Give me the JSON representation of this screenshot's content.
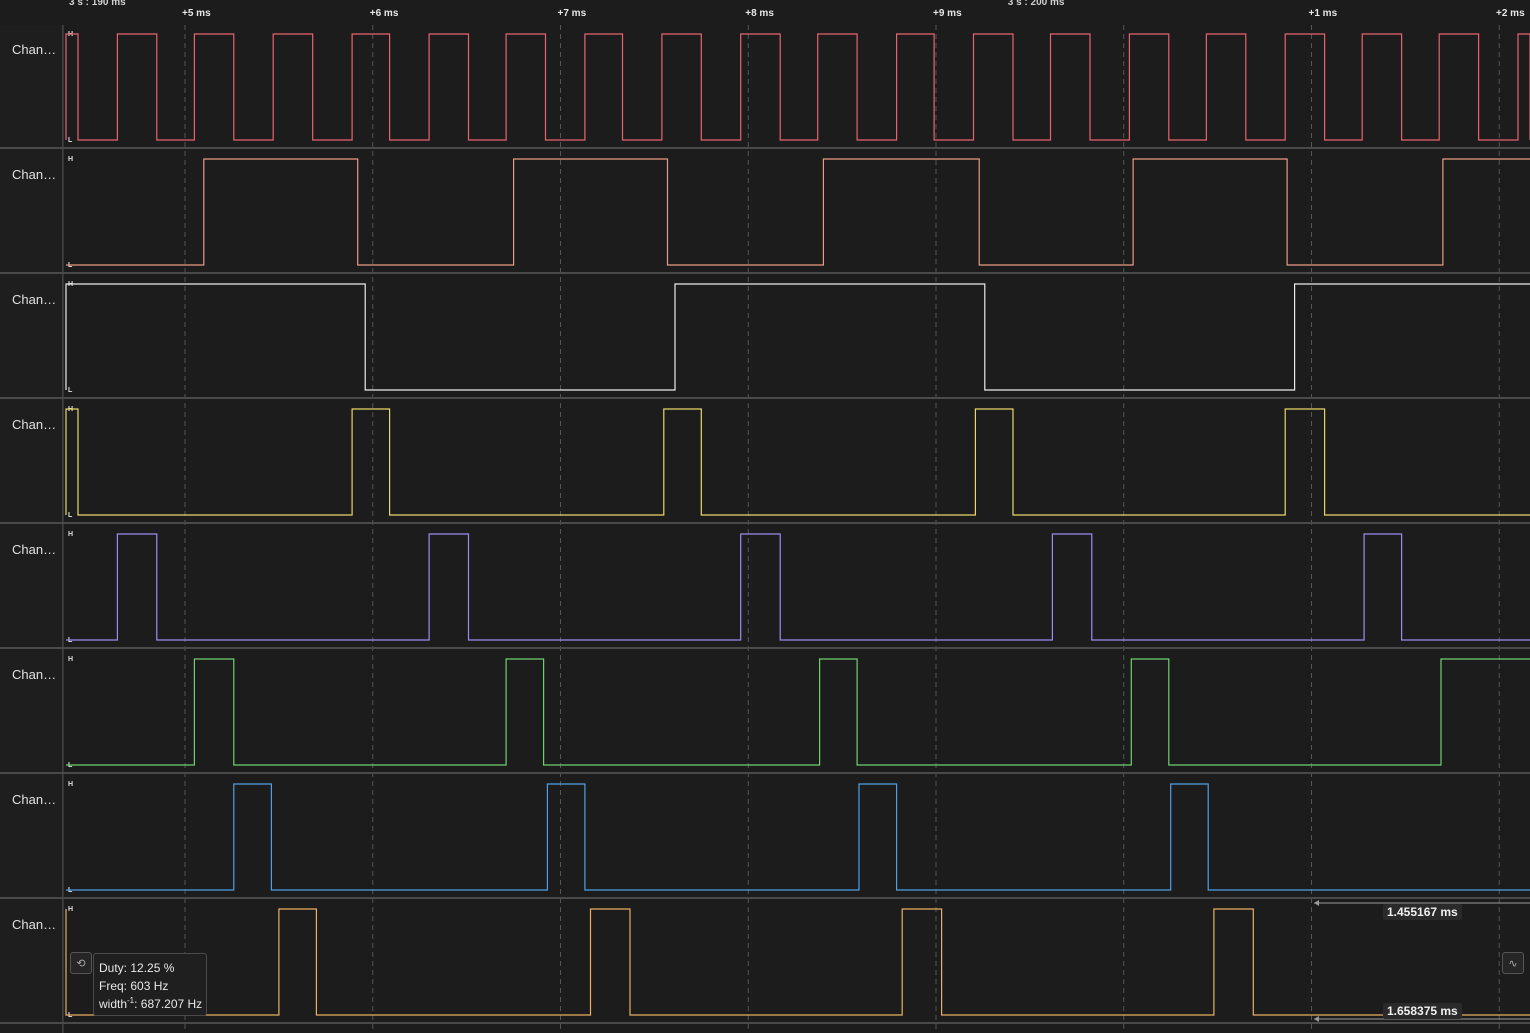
{
  "ruler": {
    "ticks": [
      {
        "text": "3 s : 190 ms",
        "time_ms": 3190.0,
        "absolute": true
      },
      {
        "text": "+5 ms",
        "time_ms": 3195.0
      },
      {
        "text": "+6 ms",
        "time_ms": 3196.0
      },
      {
        "text": "+7 ms",
        "time_ms": 3197.0
      },
      {
        "text": "+8 ms",
        "time_ms": 3198.0
      },
      {
        "text": "+9 ms",
        "time_ms": 3199.0
      },
      {
        "text": "3 s : 200 ms",
        "time_ms": 3200.0,
        "absolute": true
      },
      {
        "text": "+1 ms",
        "time_ms": 3201.0
      },
      {
        "text": "+2 ms",
        "time_ms": 3202.0
      }
    ]
  },
  "channels": [
    {
      "label": "Chan…",
      "color": "#e8636f",
      "high": "H",
      "low": "L",
      "start_level": 0,
      "transitions_ms": [
        3194.23,
        3194.43,
        3194.64,
        3194.85,
        3195.05,
        3195.26,
        3195.47,
        3195.68,
        3195.89,
        3196.09,
        3196.3,
        3196.51,
        3196.71,
        3196.92,
        3197.13,
        3197.33,
        3197.54,
        3197.75,
        3197.96,
        3198.17,
        3198.37,
        3198.58,
        3198.79,
        3198.99,
        3199.2,
        3199.41,
        3199.61,
        3199.82,
        3200.03,
        3200.24,
        3200.44,
        3200.65,
        3200.86,
        3201.07,
        3201.27,
        3201.48,
        3201.68,
        3201.89,
        3202.1,
        3202.31
      ]
    },
    {
      "label": "Chan…",
      "color": "#e89a82",
      "high": "H",
      "low": "L",
      "start_level": 0,
      "transitions_ms": [
        3195.1,
        3195.92,
        3196.75,
        3197.57,
        3198.4,
        3199.23,
        3200.05,
        3200.87,
        3201.7
      ]
    },
    {
      "label": "Chan…",
      "color": "#ececec",
      "high": "H",
      "low": "L",
      "start_level": 0,
      "transitions_ms": [
        3194.31,
        3195.96,
        3197.61,
        3199.26,
        3200.91
      ]
    },
    {
      "label": "Chan…",
      "color": "#e8d66a",
      "high": "H",
      "low": "L",
      "start_level": 0,
      "transitions_ms": [
        3194.23,
        3194.43,
        3195.89,
        3196.09,
        3197.55,
        3197.75,
        3199.21,
        3199.41,
        3200.86,
        3201.07
      ]
    },
    {
      "label": "Chan…",
      "color": "#9c8cf0",
      "high": "H",
      "low": "L",
      "start_level": 0,
      "transitions_ms": [
        3194.64,
        3194.85,
        3196.3,
        3196.51,
        3197.96,
        3198.17,
        3199.62,
        3199.83,
        3201.28,
        3201.48
      ]
    },
    {
      "label": "Chan…",
      "color": "#6fd06f",
      "high": "H",
      "low": "L",
      "start_level": 0,
      "transitions_ms": [
        3195.05,
        3195.26,
        3196.71,
        3196.91,
        3198.38,
        3198.58,
        3200.04,
        3200.24,
        3201.69
      ]
    },
    {
      "label": "Chan…",
      "color": "#4f9ee8",
      "high": "H",
      "low": "L",
      "start_level": 0,
      "transitions_ms": [
        3195.26,
        3195.46,
        3196.93,
        3197.13,
        3198.59,
        3198.79,
        3200.25,
        3200.45
      ]
    },
    {
      "label": "Chan…",
      "color": "#e8b062",
      "high": "H",
      "low": "L",
      "start_level": 1,
      "transitions_ms": [
        3194.04,
        3195.5,
        3195.7,
        3197.16,
        3197.37,
        3198.82,
        3199.03,
        3200.48,
        3200.69
      ]
    }
  ],
  "tooltip": {
    "duty": "Duty: 12.25 %",
    "freq": "Freq: 603 Hz",
    "width_prefix": "width",
    "width_exp": "-1",
    "width_value": ": 687.207 Hz"
  },
  "measurements": {
    "period": "1.455167 ms",
    "width": "1.658375 ms"
  },
  "icons": {
    "left_tool": "edge-measure-icon",
    "right_tool": "pulse-measure-icon"
  },
  "colors": {
    "background": "#1c1c1c",
    "separator": "#4a4a4a",
    "grid": "#555555"
  }
}
